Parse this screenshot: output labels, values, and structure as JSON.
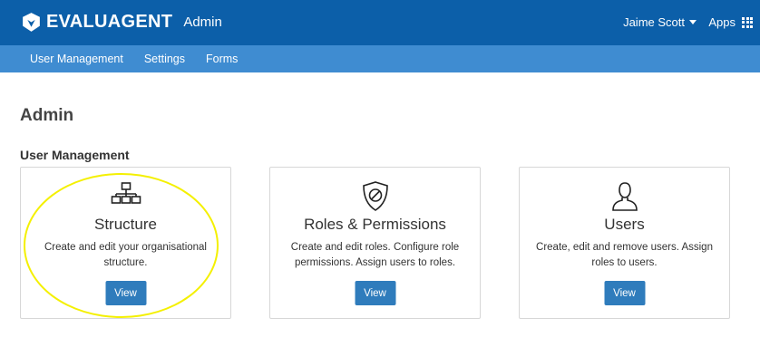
{
  "header": {
    "brand": "EVALUAGENT",
    "section": "Admin",
    "user_name": "Jaime Scott",
    "apps_label": "Apps"
  },
  "subnav": {
    "items": [
      "User Management",
      "Settings",
      "Forms"
    ]
  },
  "page": {
    "title": "Admin",
    "section_title": "User Management"
  },
  "cards": [
    {
      "icon": "org-structure-icon",
      "title": "Structure",
      "description": "Create and edit your organisational structure.",
      "button": "View"
    },
    {
      "icon": "shield-icon",
      "title": "Roles & Permissions",
      "description": "Create and edit roles. Configure role permissions. Assign users to roles.",
      "button": "View"
    },
    {
      "icon": "user-icon",
      "title": "Users",
      "description": "Create, edit and remove users. Assign roles to users.",
      "button": "View"
    }
  ],
  "colors": {
    "header_bg": "#0c5fa9",
    "subnav_bg": "#3f8cd1",
    "button_bg": "#2f7cbc",
    "highlight": "#f4f000"
  }
}
